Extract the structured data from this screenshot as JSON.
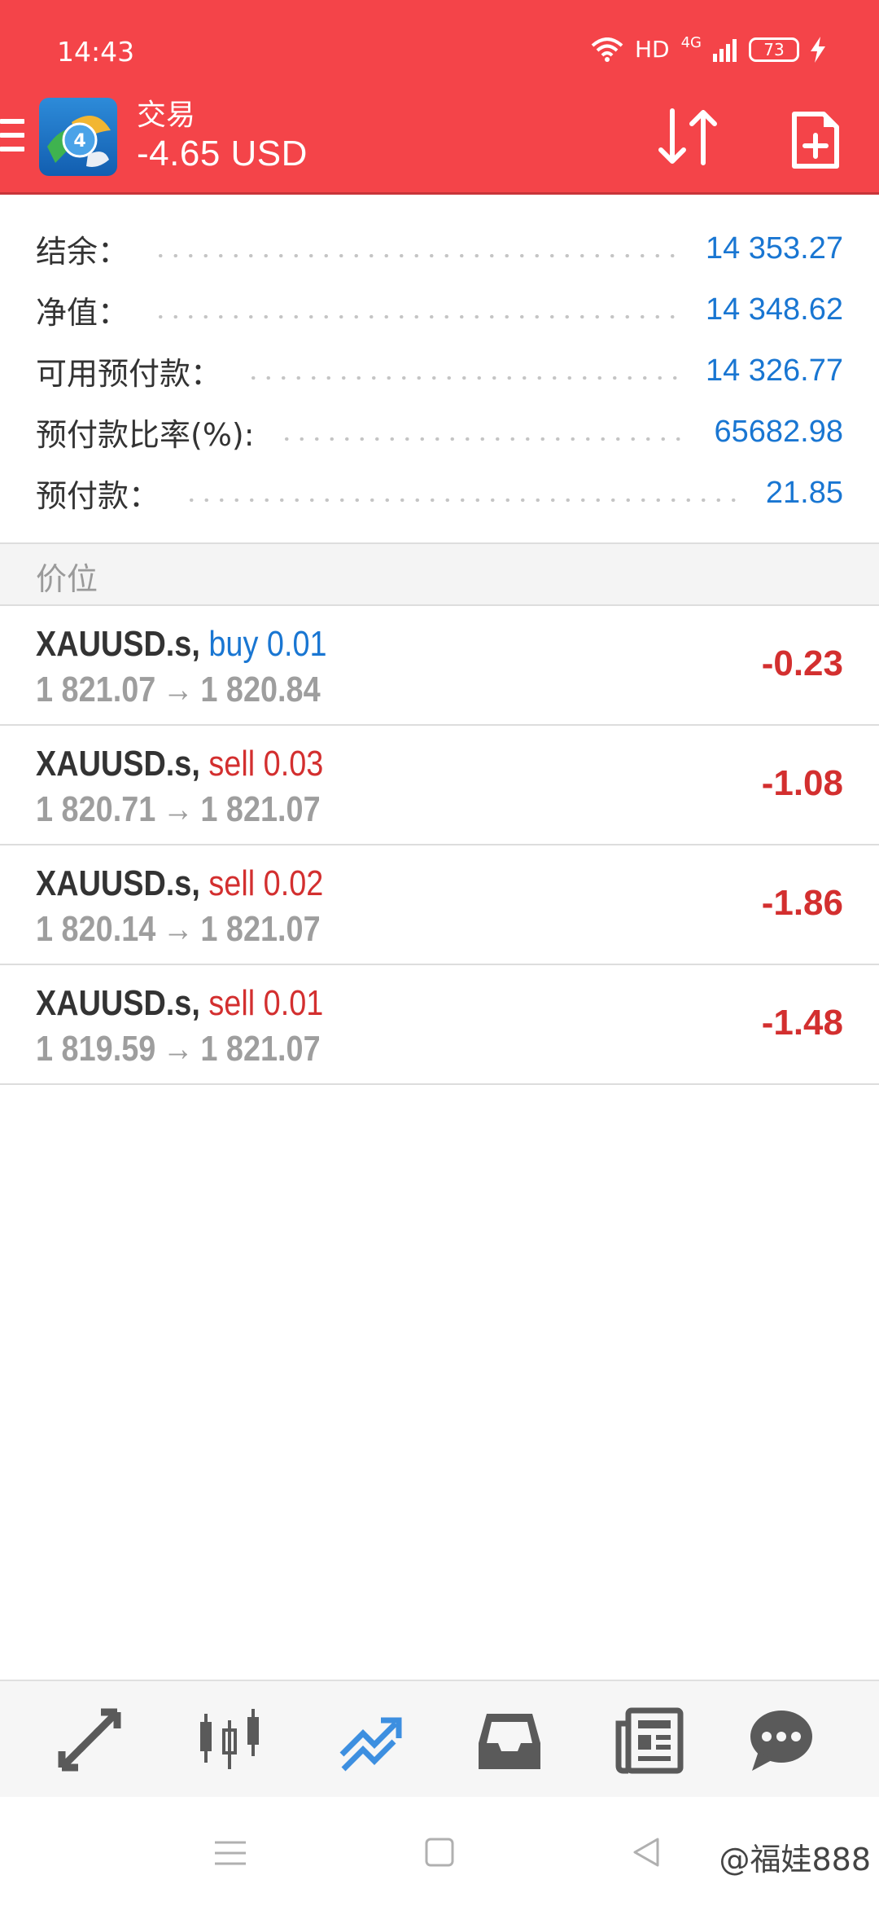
{
  "status_bar": {
    "time": "14:43",
    "hd_label": "HD",
    "network_label": "4G",
    "battery": "73"
  },
  "header": {
    "title": "交易",
    "balance": "-4.65 USD",
    "background_color": "#f44449",
    "icons": [
      "menu-icon",
      "app-logo",
      "sort-icon",
      "new-order-icon"
    ]
  },
  "summary": [
    {
      "label": "结余：",
      "value": "14 353.27"
    },
    {
      "label": "净值：",
      "value": "14 348.62"
    },
    {
      "label": "可用预付款：",
      "value": "14 326.77"
    },
    {
      "label": "预付款比率(%):",
      "value": "65682.98"
    },
    {
      "label": "预付款：",
      "value": "21.85"
    }
  ],
  "section": {
    "title": "价位"
  },
  "positions": [
    {
      "symbol": "XAUUSD.s,",
      "side": "buy",
      "side_text": "buy 0.01",
      "open_price": "1 821.07",
      "arrow": "→",
      "current_price": "1 820.84",
      "profit": "-0.23"
    },
    {
      "symbol": "XAUUSD.s,",
      "side": "sell",
      "side_text": "sell 0.03",
      "open_price": "1 820.71",
      "arrow": "→",
      "current_price": "1 821.07",
      "profit": "-1.08"
    },
    {
      "symbol": "XAUUSD.s,",
      "side": "sell",
      "side_text": "sell 0.02",
      "open_price": "1 820.14",
      "arrow": "→",
      "current_price": "1 821.07",
      "profit": "-1.86"
    },
    {
      "symbol": "XAUUSD.s,",
      "side": "sell",
      "side_text": "sell 0.01",
      "open_price": "1 819.59",
      "arrow": "→",
      "current_price": "1 821.07",
      "profit": "-1.48"
    }
  ],
  "colors": {
    "value_blue": "#1976d2",
    "sell_red": "#d32f2f",
    "active_tab": "#3d8fe0",
    "inactive_tab": "#5a5a5a"
  },
  "tabbar": {
    "tabs": [
      {
        "icon": "quotes-icon",
        "active": false
      },
      {
        "icon": "chart-icon",
        "active": false
      },
      {
        "icon": "trade-icon",
        "active": true
      },
      {
        "icon": "history-icon",
        "active": false
      },
      {
        "icon": "news-icon",
        "active": false
      },
      {
        "icon": "messages-icon",
        "active": false
      }
    ]
  },
  "navbar": {
    "icons": [
      "recent-apps-icon",
      "home-icon",
      "back-icon"
    ]
  },
  "watermark": "@福娃888"
}
